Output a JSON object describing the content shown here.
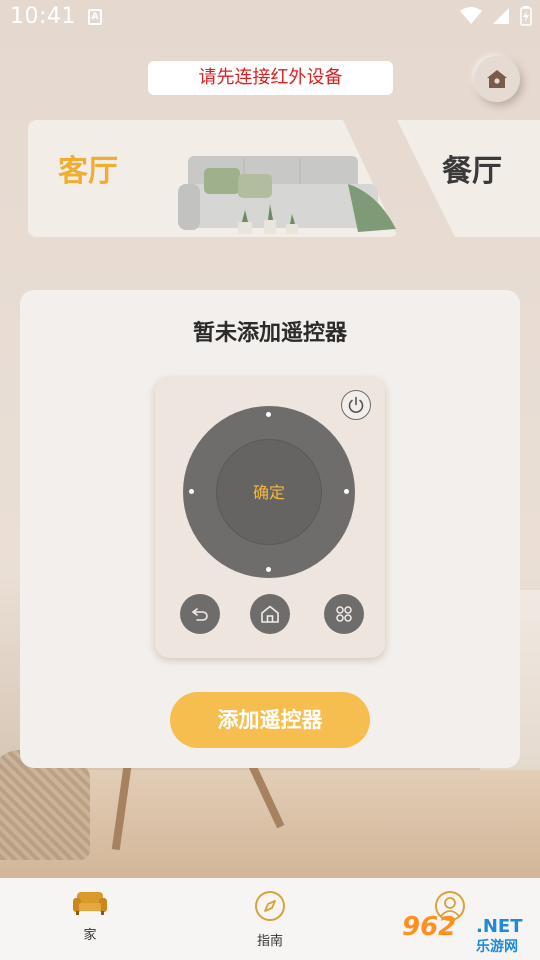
{
  "status_bar": {
    "time": "10:41",
    "app_icon_letter": "A"
  },
  "header": {
    "connect_prompt": "请先连接红外设备"
  },
  "rooms": [
    {
      "label": "客厅",
      "selected": true
    },
    {
      "label": "餐厅",
      "selected": false
    }
  ],
  "panel": {
    "title": "暂未添加遥控器",
    "remote": {
      "ok_label": "确定"
    },
    "add_button_label": "添加遥控器"
  },
  "bottom_nav": [
    {
      "label": "家",
      "icon": "sofa-icon",
      "active": true
    },
    {
      "label": "指南",
      "icon": "compass-icon",
      "active": false
    },
    {
      "label": "",
      "icon": "user-icon",
      "active": false
    }
  ],
  "watermark": {
    "number": "962",
    "domain": ".NET",
    "name": "乐游网"
  },
  "colors": {
    "accent": "#f6be4f",
    "room_active": "#f0ad32",
    "warning": "#e02020",
    "remote_body": "#6f6d6b"
  }
}
